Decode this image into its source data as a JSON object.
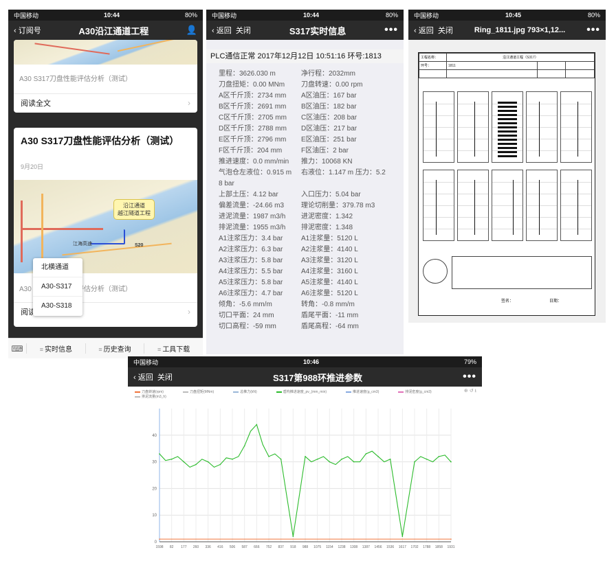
{
  "phone1": {
    "status": {
      "carrier": "中国移动",
      "time": "10:44",
      "battery": "80%"
    },
    "nav": {
      "back_label": "订阅号",
      "title": "A30沿江通道工程",
      "person_icon": "person-icon"
    },
    "card1": {
      "caption": "A30 S317刀盘性能评估分析（测试）",
      "read_all": "阅读全文"
    },
    "card2": {
      "title": "A30 S317刀盘性能评估分析（测试）",
      "date": "9月20日",
      "bubble_line1": "沿江通道",
      "bubble_line2": "越江隧道工程",
      "map_label1": "江海高速",
      "map_label2": "S20",
      "caption": "A30 S317刀盘性能评估分析（测试）",
      "read_all": "阅读全文"
    },
    "popup": [
      "北横通道",
      "A30-S317",
      "A30-S318"
    ],
    "tabbar": {
      "keyboard_icon": "keyboard-icon",
      "tabs": [
        "实时信息",
        "历史查询",
        "工具下载"
      ]
    }
  },
  "phone2": {
    "status": {
      "carrier": "中国移动",
      "time": "10:44",
      "battery": "80%"
    },
    "nav": {
      "back_label": "返回",
      "close_label": "关闭",
      "title": "S317实时信息"
    },
    "header": "PLC通信正常   2017年12月12日  10:51:16   环号:1813",
    "rows": [
      [
        "里程：3626.030 m",
        "净行程：2032mm"
      ],
      [
        "刀盘扭矩：0.00 MNm",
        "刀盘转速：0.00 rpm"
      ],
      [
        "A区千斤顶：2734 mm",
        "A区油压：167 bar"
      ],
      [
        "B区千斤顶：2691 mm",
        "B区油压：182 bar"
      ],
      [
        "C区千斤顶：2705 mm",
        "C区油压：208 bar"
      ],
      [
        "D区千斤顶：2788 mm",
        "D区油压：217 bar"
      ],
      [
        "E区千斤顶：2796 mm",
        "E区油压：251 bar"
      ],
      [
        "F区千斤顶：204 mm",
        "F区油压：2 bar"
      ],
      [
        "推进速度：0.0 mm/min",
        "推力：10068 KN"
      ],
      [
        "气泡仓左液位：0.915 m",
        "右液位：1.147 m  压力：5.2"
      ],
      [
        "8 bar",
        ""
      ],
      [
        "上部土压：4.12 bar",
        "入口压力：5.04 bar"
      ],
      [
        "偏差流量：-24.66 m3",
        "理论切削量：379.78 m3"
      ],
      [
        "进泥流量：1987 m3/h",
        "进泥密度：1.342"
      ],
      [
        "排泥流量：1955 m3/h",
        "排泥密度：1.348"
      ],
      [
        "A1注浆压力：3.4 bar",
        "A1注浆量：5120 L"
      ],
      [
        "A2注浆压力：6.3 bar",
        "A2注浆量：4140 L"
      ],
      [
        "A3注浆压力：5.8 bar",
        "A3注浆量：3120 L"
      ],
      [
        "A4注浆压力：5.5 bar",
        "A4注浆量：3160 L"
      ],
      [
        "A5注浆压力：5.8 bar",
        "A5注浆量：4140 L"
      ],
      [
        "A6注浆压力：4.7 bar",
        "A6注浆量：5120 L"
      ],
      [
        "  倾角：-5.6 mm/m",
        "  转角：-0.8 mm/m"
      ],
      [
        "切口平面：24 mm",
        "盾尾平面：-11 mm"
      ],
      [
        "切口高程：-59 mm",
        "盾尾高程：-64 mm"
      ]
    ]
  },
  "phone3": {
    "status": {
      "carrier": "中国移动",
      "time": "10:45",
      "battery": "80%"
    },
    "nav": {
      "back_label": "返回",
      "close_label": "关闭",
      "title": "Ring_1811.jpg 793×1,12..."
    },
    "doc": {
      "project_label": "工程名称：",
      "project_value": "沿江通道工程（S317）",
      "ring_label": "环号：",
      "ring_value": "1811",
      "sign_label": "签名：",
      "date_label": "日期："
    }
  },
  "phone4": {
    "status": {
      "carrier": "中国移动",
      "time": "10:46",
      "battery": "79%"
    },
    "nav": {
      "back_label": "返回",
      "close_label": "关闭",
      "title": "S317第988环推进参数"
    },
    "legend": [
      "刀盘转速(rpm)",
      "刀盘扭矩(MNm)",
      "总推力(kN)",
      "盾构推进速度_pv_(mm_min)",
      "推进速度(g_cm3)",
      "排泥密度(g_cm3)",
      "排泥流量(m3_h)"
    ],
    "legend_colors": [
      "#f0743a",
      "#bbbbbb",
      "#9ab7d8",
      "#2bbb2b",
      "#86a9e0",
      "#e070b8",
      "#bbbbbb"
    ]
  },
  "chart_data": {
    "type": "line",
    "title": "",
    "xlabel": "",
    "ylabel": "",
    "ylim": [
      0,
      50
    ],
    "x_ticks": [
      "1598",
      "82",
      "177",
      "260",
      "336",
      "416",
      "506",
      "587",
      "666",
      "752",
      "837",
      "918",
      "988",
      "1075",
      "1154",
      "1238",
      "1308",
      "1387",
      "1456",
      "1536",
      "1617",
      "1702",
      "1788",
      "1858",
      "1931"
    ],
    "y_ticks": [
      0,
      10,
      20,
      30,
      40
    ],
    "series": [
      {
        "name": "盾构推进速度_pv_(mm_min)",
        "color": "#2bbb2b",
        "x": [
          0,
          1,
          2,
          3,
          4,
          5,
          6,
          7,
          8,
          9,
          10,
          11,
          12,
          13,
          14,
          15,
          16,
          17,
          18,
          19,
          20,
          21,
          22,
          23,
          24
        ],
        "values": [
          33,
          31,
          30,
          29,
          30,
          29,
          31,
          36,
          44,
          32,
          31,
          2,
          32,
          31,
          30,
          31,
          30,
          33,
          32,
          31,
          2,
          30,
          31,
          32,
          30
        ]
      },
      {
        "name": "刀盘转速(rpm)",
        "color": "#f0743a",
        "x": [
          0,
          24
        ],
        "values": [
          1,
          1
        ]
      }
    ]
  }
}
